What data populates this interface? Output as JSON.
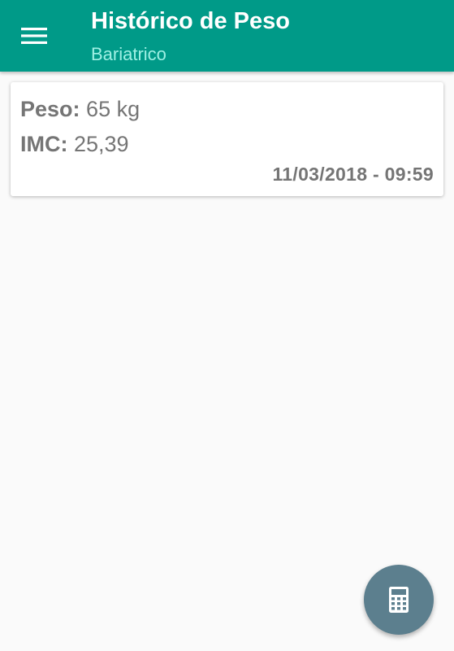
{
  "appbar": {
    "title": "Histórico de Peso",
    "subtitle": "Bariatrico",
    "menu_icon": "hamburger-menu-icon",
    "background_color": "#009a88"
  },
  "entries": [
    {
      "peso_label": "Peso:",
      "peso_value": "65 kg",
      "imc_label": "IMC:",
      "imc_value": "25,39",
      "datetime": "11/03/2018 - 09:59"
    }
  ],
  "fab": {
    "icon": "calculator-icon",
    "color": "#5c7f8e"
  }
}
